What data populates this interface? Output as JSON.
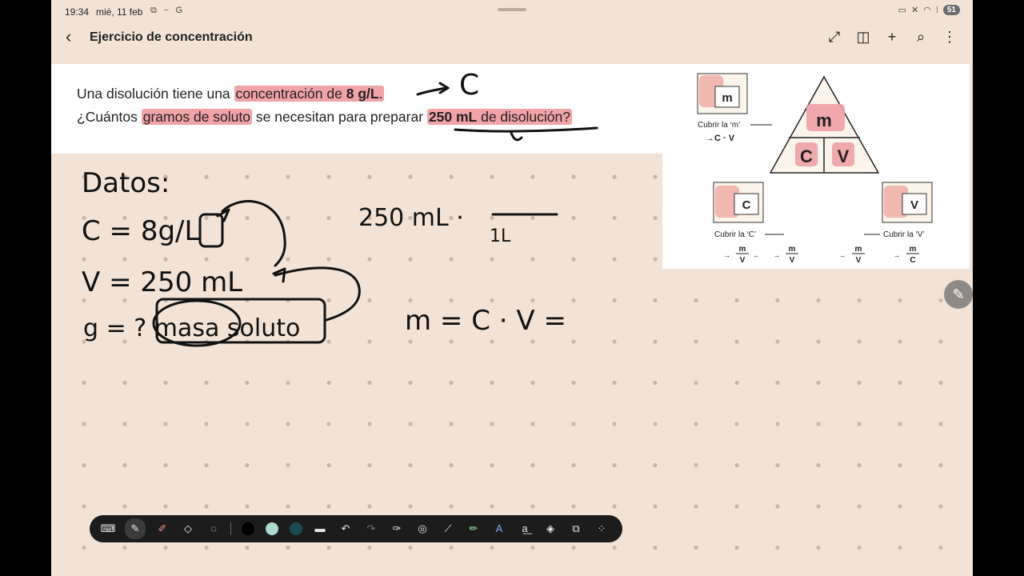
{
  "status_bar": {
    "time": "19:34",
    "date": "mié, 11 feb",
    "battery": "51"
  },
  "header": {
    "title": "Ejercicio de concentración"
  },
  "problem": {
    "line1_pre": "Una disolución tiene una",
    "line1_hl_a": "concentración de",
    "line1_hl_b": "8 g/L",
    "line1_post": ".",
    "line2_pre": "¿Cuántos",
    "line2_hl": "gramos de soluto",
    "line2_mid": "se necesitan para preparar",
    "line2_hl_b": "250 mL",
    "line2_hl_c": "de disolución",
    "line2_post": "?"
  },
  "triangle": {
    "top": "m",
    "left": "C",
    "right": "V",
    "cover_m": "Cubrir la ‘m’",
    "cover_m_result": "→C · V",
    "cover_c": "Cubrir la ‘C’",
    "cover_v": "Cubrir la ‘V’",
    "frac_m": "m",
    "frac_v": "V",
    "frac_c": "C"
  },
  "handwriting": {
    "datos": "Datos:",
    "c": "C = 8g/L",
    "v": "V = 250 mL",
    "g": "g = ? masa soluto",
    "calc": "250 mL ·",
    "calc_den": "1L",
    "formula": "m = C · V ="
  },
  "toolbar": {
    "colors": [
      "#000000",
      "#a8dcd1",
      "#1b4a55"
    ]
  },
  "colors": {
    "background": "#f2e3d6",
    "highlight": "#f1a3a8"
  }
}
